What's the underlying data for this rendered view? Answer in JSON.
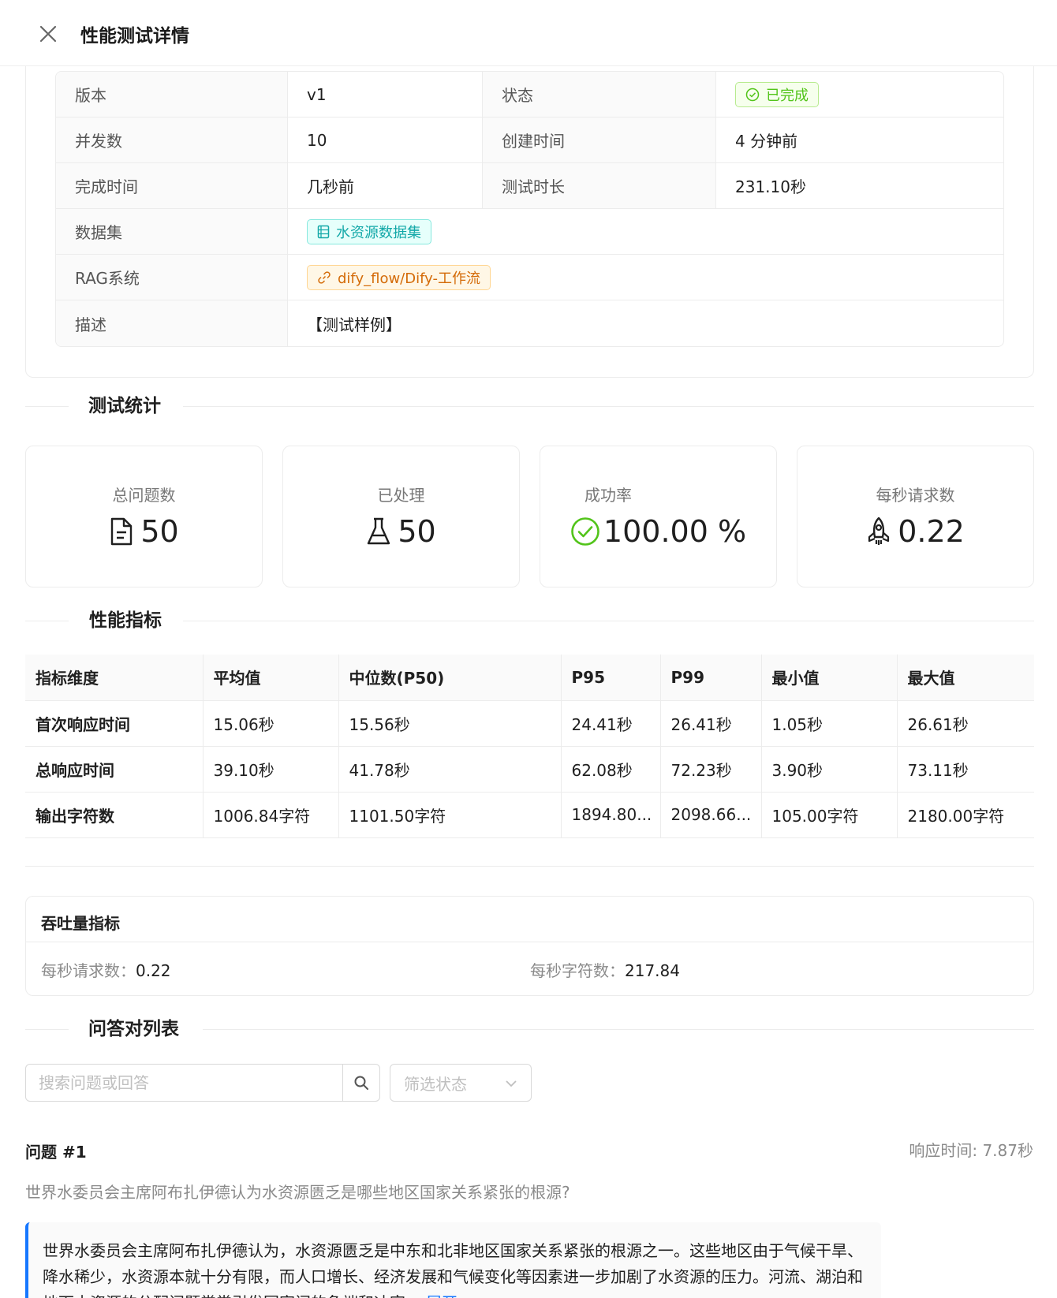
{
  "header": {
    "title": "性能测试详情"
  },
  "info": {
    "version_label": "版本",
    "version_value": "v1",
    "status_label": "状态",
    "status_value": "已完成",
    "concurrency_label": "并发数",
    "concurrency_value": "10",
    "created_label": "创建时间",
    "created_value": "4 分钟前",
    "finished_label": "完成时间",
    "finished_value": "几秒前",
    "duration_label": "测试时长",
    "duration_value": "231.10秒",
    "dataset_label": "数据集",
    "dataset_value": "水资源数据集",
    "rag_label": "RAG系统",
    "rag_value": "dify_flow/Dify-工作流",
    "desc_label": "描述",
    "desc_value": "【测试样例】"
  },
  "stats_section": {
    "title": "测试统计"
  },
  "stats": [
    {
      "title": "总问题数",
      "value": "50",
      "icon": "file-icon"
    },
    {
      "title": "已处理",
      "value": "50",
      "icon": "flask-icon"
    },
    {
      "title": "成功率",
      "value": "100.00 %",
      "icon": "check-circle-icon"
    },
    {
      "title": "每秒请求数",
      "value": "0.22",
      "icon": "rocket-icon"
    }
  ],
  "metrics_section": {
    "title": "性能指标"
  },
  "metrics": {
    "headers": [
      "指标维度",
      "平均值",
      "中位数(P50)",
      "P95",
      "P99",
      "最小值",
      "最大值"
    ],
    "rows": [
      [
        "首次响应时间",
        "15.06秒",
        "15.56秒",
        "24.41秒",
        "26.41秒",
        "1.05秒",
        "26.61秒"
      ],
      [
        "总响应时间",
        "39.10秒",
        "41.78秒",
        "62.08秒",
        "72.23秒",
        "3.90秒",
        "73.11秒"
      ],
      [
        "输出字符数",
        "1006.84字符",
        "1101.50字符",
        "1894.80...",
        "2098.66...",
        "105.00字符",
        "2180.00字符"
      ]
    ]
  },
  "throughput": {
    "title": "吞吐量指标",
    "rps_label": "每秒请求数：",
    "rps_value": "0.22",
    "cps_label": "每秒字符数：",
    "cps_value": "217.84"
  },
  "qa_section": {
    "title": "问答对列表"
  },
  "qa_filters": {
    "search_placeholder": "搜索问题或回答",
    "status_placeholder": "筛选状态"
  },
  "qa_items": [
    {
      "title": "问题 #1",
      "response_time": "响应时间: 7.87秒",
      "question": "世界水委员会主席阿布扎伊德认为水资源匮乏是哪些地区国家关系紧张的根源?",
      "answer": "世界水委员会主席阿布扎伊德认为，水资源匮乏是中东和北非地区国家关系紧张的根源之一。这些地区由于气候干旱、降水稀少，水资源本就十分有限，而人口增长、经济发展和气候变化等因素进一步加剧了水资源的压力。河流、湖泊和地下水资源的分配问题常常引发国家间的争端和冲突。",
      "expand_label": "展开"
    }
  ],
  "colors": {
    "accent": "#1677ff",
    "success": "#52c41a",
    "border": "#ececec"
  }
}
